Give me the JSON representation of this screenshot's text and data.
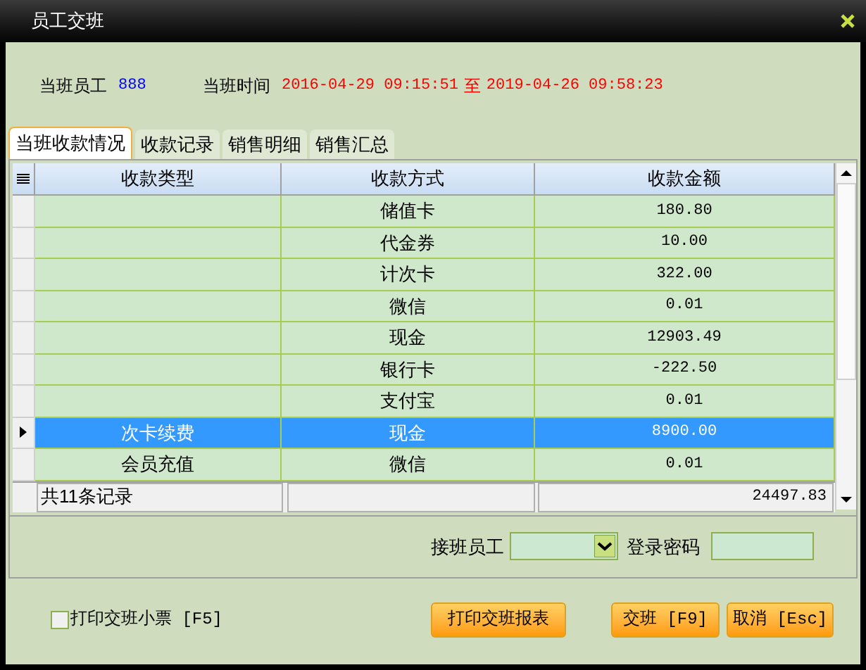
{
  "window": {
    "title": "员工交班"
  },
  "info": {
    "employee_label": "当班员工",
    "employee": "888",
    "time_label": "当班时间",
    "start": "2016-04-29 09:15:51",
    "to": "至",
    "end": "2019-04-26 09:58:23"
  },
  "tabs": [
    {
      "label": "当班收款情况",
      "selected": true
    },
    {
      "label": "收款记录",
      "selected": false
    },
    {
      "label": "销售明细",
      "selected": false
    },
    {
      "label": "销售汇总",
      "selected": false
    }
  ],
  "table": {
    "columns": [
      "收款类型",
      "收款方式",
      "收款金额"
    ],
    "rows": [
      {
        "type": "",
        "method": "储值卡",
        "amount": "180.80",
        "selected": false
      },
      {
        "type": "",
        "method": "代金券",
        "amount": "10.00",
        "selected": false
      },
      {
        "type": "",
        "method": "计次卡",
        "amount": "322.00",
        "selected": false
      },
      {
        "type": "",
        "method": "微信",
        "amount": "0.01",
        "selected": false
      },
      {
        "type": "",
        "method": "现金",
        "amount": "12903.49",
        "selected": false
      },
      {
        "type": "",
        "method": "银行卡",
        "amount": "-222.50",
        "selected": false
      },
      {
        "type": "",
        "method": "支付宝",
        "amount": "0.01",
        "selected": false
      },
      {
        "type": "次卡续费",
        "method": "现金",
        "amount": "8900.00",
        "selected": true
      },
      {
        "type": "会员充值",
        "method": "微信",
        "amount": "0.01",
        "selected": false
      }
    ],
    "footer": {
      "count": "共11条记录",
      "total": "24497.83"
    }
  },
  "handover": {
    "employee_label": "接班员工",
    "password_label": "登录密码"
  },
  "print_slip": {
    "label": "打印交班小票 [F5]",
    "checked": false
  },
  "buttons": [
    "打印交班报表",
    "交班 [F9]",
    "取消 [Esc]"
  ]
}
